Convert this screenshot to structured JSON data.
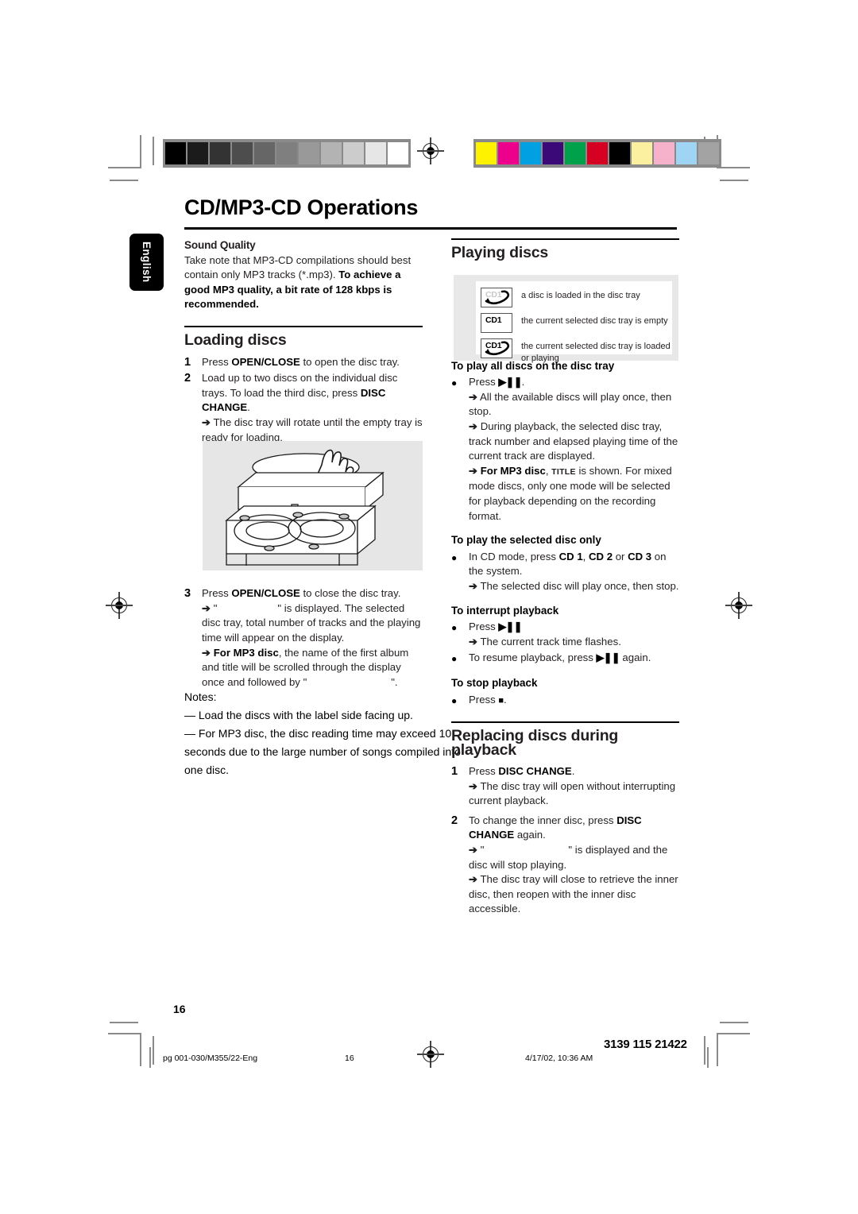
{
  "document": {
    "page_title": "CD/MP3-CD Operations",
    "language_tab": "English",
    "page_number": "16"
  },
  "color_bars": {
    "grayscale": [
      "#000000",
      "#1b1b1b",
      "#333333",
      "#4d4d4d",
      "#666666",
      "#7f7f7f",
      "#999999",
      "#b3b3b3",
      "#cccccc",
      "#e6e6e6",
      "#ffffff"
    ],
    "color": [
      "#fff200",
      "#ec008c",
      "#00a0e3",
      "#3b0a78",
      "#00a14b",
      "#d60023",
      "#000000",
      "#faf0a0",
      "#f7b2cb",
      "#9fd4f4",
      "#a3a3a3"
    ]
  },
  "left_column": {
    "sound_quality": {
      "heading": "Sound Quality",
      "text_plain": "Take note that MP3-CD compilations should best contain only MP3 tracks (*.mp3). ",
      "text_bold": "To achieve a good MP3 quality, a bit rate of 128 kbps is recommended."
    },
    "loading_discs": {
      "heading": "Loading discs",
      "steps": [
        {
          "num": "1",
          "pre": "Press ",
          "key": "OPEN/CLOSE",
          "post": " to open the disc tray."
        },
        {
          "num": "2",
          "pre": "Load up to two discs on the individual disc trays. To load the third disc, press ",
          "key": "DISC CHANGE",
          "post": ".",
          "result": "The disc tray will rotate until the empty tray is ready for loading."
        },
        {
          "num": "3",
          "pre": "Press ",
          "key": "OPEN/CLOSE",
          "post": " to close the disc tray.",
          "result": "\" \" is displayed. The selected disc tray, total number of tracks and the playing time will appear on the display.",
          "result2_bold": "For MP3 disc",
          "result2": ", the name of the first album and title will be scrolled through the display once and followed by \" \"."
        }
      ]
    },
    "notes": {
      "label": "Notes:",
      "items": [
        "— Load the discs with the label side facing up.",
        "— For MP3 disc, the disc reading time may exceed 10 seconds due to the large number of songs compiled into one disc."
      ]
    },
    "illustration_name": "cd-player-loading-illustration"
  },
  "right_column": {
    "playing_discs": {
      "heading": "Playing discs",
      "legend": [
        {
          "icon": "cd1-disc-loaded-icon",
          "label": "CD1",
          "faint": true,
          "swoosh": true,
          "text": "a disc is loaded in the disc tray"
        },
        {
          "icon": "cd1-tray-empty-icon",
          "label": "CD1",
          "faint": false,
          "swoosh": false,
          "text": "the current selected disc tray is empty"
        },
        {
          "icon": "cd1-tray-loaded-playing-icon",
          "label": "CD1",
          "faint": false,
          "swoosh": true,
          "text": "the current selected disc tray is loaded or playing"
        }
      ]
    },
    "play_all": {
      "heading": "To play all discs on the disc tray",
      "bullet_pre": "Press ",
      "bullet_key": "▶❚❚",
      "bullet_post": ".",
      "results": [
        "All the available discs will play once, then stop.",
        "During playback, the selected disc tray, track number and elapsed playing time of the current track are displayed."
      ],
      "result_mp3_bold": "For MP3 disc",
      "result_mp3_caps": "TITLE",
      "result_mp3_rest": " is shown.  For mixed mode discs, only one mode will be selected for playback depending on the recording format."
    },
    "play_selected": {
      "heading": "To play the selected disc only",
      "bullet_pre": "In CD mode, press ",
      "keys": [
        "CD 1",
        "CD 2",
        "CD 3"
      ],
      "bullet_mid": ", ",
      "bullet_or": " or ",
      "bullet_post": " on the system.",
      "result": "The selected disc will play once, then stop."
    },
    "interrupt": {
      "heading": "To interrupt playback",
      "bullet_pre": "Press ",
      "bullet_key": "▶❚❚",
      "result": "The current track time flashes.",
      "bullet2_pre": "To resume playback, press ",
      "bullet2_key": "▶❚❚",
      "bullet2_post": " again."
    },
    "stop": {
      "heading": "To stop playback",
      "bullet_pre": "Press ",
      "bullet_key": "■",
      "bullet_post": "."
    },
    "replacing": {
      "heading": "Replacing discs during playback",
      "steps": [
        {
          "num": "1",
          "pre": "Press ",
          "key": "DISC CHANGE",
          "post": ".",
          "result": "The disc tray will open without interrupting current playback."
        },
        {
          "num": "2",
          "pre": "To change the inner disc, press ",
          "key": "DISC CHANGE",
          "post": " again.",
          "result": "\" \" is displayed and the disc will stop playing.",
          "result2": "The disc tray will close to retrieve the inner disc, then reopen with the inner disc accessible."
        }
      ]
    }
  },
  "footer": {
    "file": "pg 001-030/M355/22-Eng",
    "page": "16",
    "timestamp": "4/17/02, 10:36 AM",
    "job_number": "3139 115 21422"
  }
}
